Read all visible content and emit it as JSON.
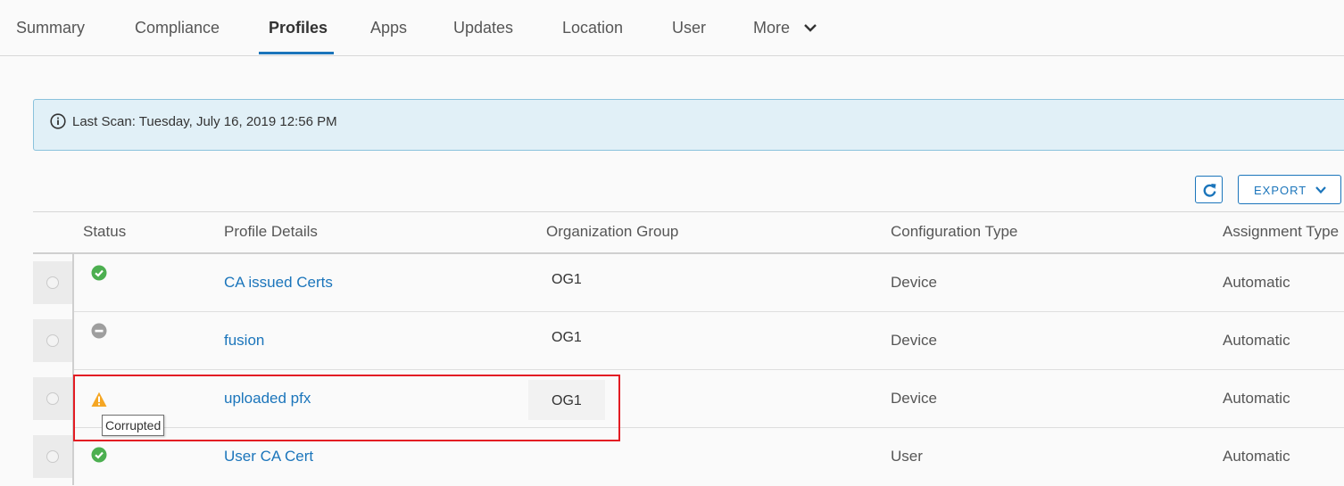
{
  "tabs": [
    {
      "label": "Summary",
      "active": false
    },
    {
      "label": "Compliance",
      "active": false
    },
    {
      "label": "Profiles",
      "active": true
    },
    {
      "label": "Apps",
      "active": false
    },
    {
      "label": "Updates",
      "active": false
    },
    {
      "label": "Location",
      "active": false
    },
    {
      "label": "User",
      "active": false
    },
    {
      "label": "More",
      "active": false
    }
  ],
  "banner": {
    "text": "Last Scan: Tuesday, July 16, 2019 12:56 PM",
    "icon": "info-circle-icon"
  },
  "toolbar": {
    "export_label": "EXPORT",
    "refresh_icon": "refresh-icon"
  },
  "columns": [
    "Status",
    "Profile Details",
    "Organization Group",
    "Configuration Type",
    "Assignment Type"
  ],
  "rows": [
    {
      "status": "installed",
      "status_icon": "check-circle-icon",
      "profile": "CA issued Certs",
      "og": "OG1",
      "config": "Device",
      "assignment": "Automatic"
    },
    {
      "status": "not-installed",
      "status_icon": "minus-circle-icon",
      "profile": "fusion",
      "og": "OG1",
      "config": "Device",
      "assignment": "Automatic"
    },
    {
      "status": "corrupted",
      "status_icon": "warning-icon",
      "profile": "uploaded pfx",
      "og": "OG1",
      "config": "Device",
      "assignment": "Automatic"
    },
    {
      "status": "installed",
      "status_icon": "check-circle-icon",
      "profile": "User CA Cert",
      "og": "",
      "config": "User",
      "assignment": "Automatic"
    }
  ],
  "tooltip": {
    "text": "Corrupted"
  },
  "colors": {
    "accent": "#1b75bb",
    "success": "#4caf50",
    "warning": "#f5a623",
    "neutral": "#9e9e9e",
    "highlight": "#e31c23",
    "banner_bg": "#e1f0f7"
  }
}
